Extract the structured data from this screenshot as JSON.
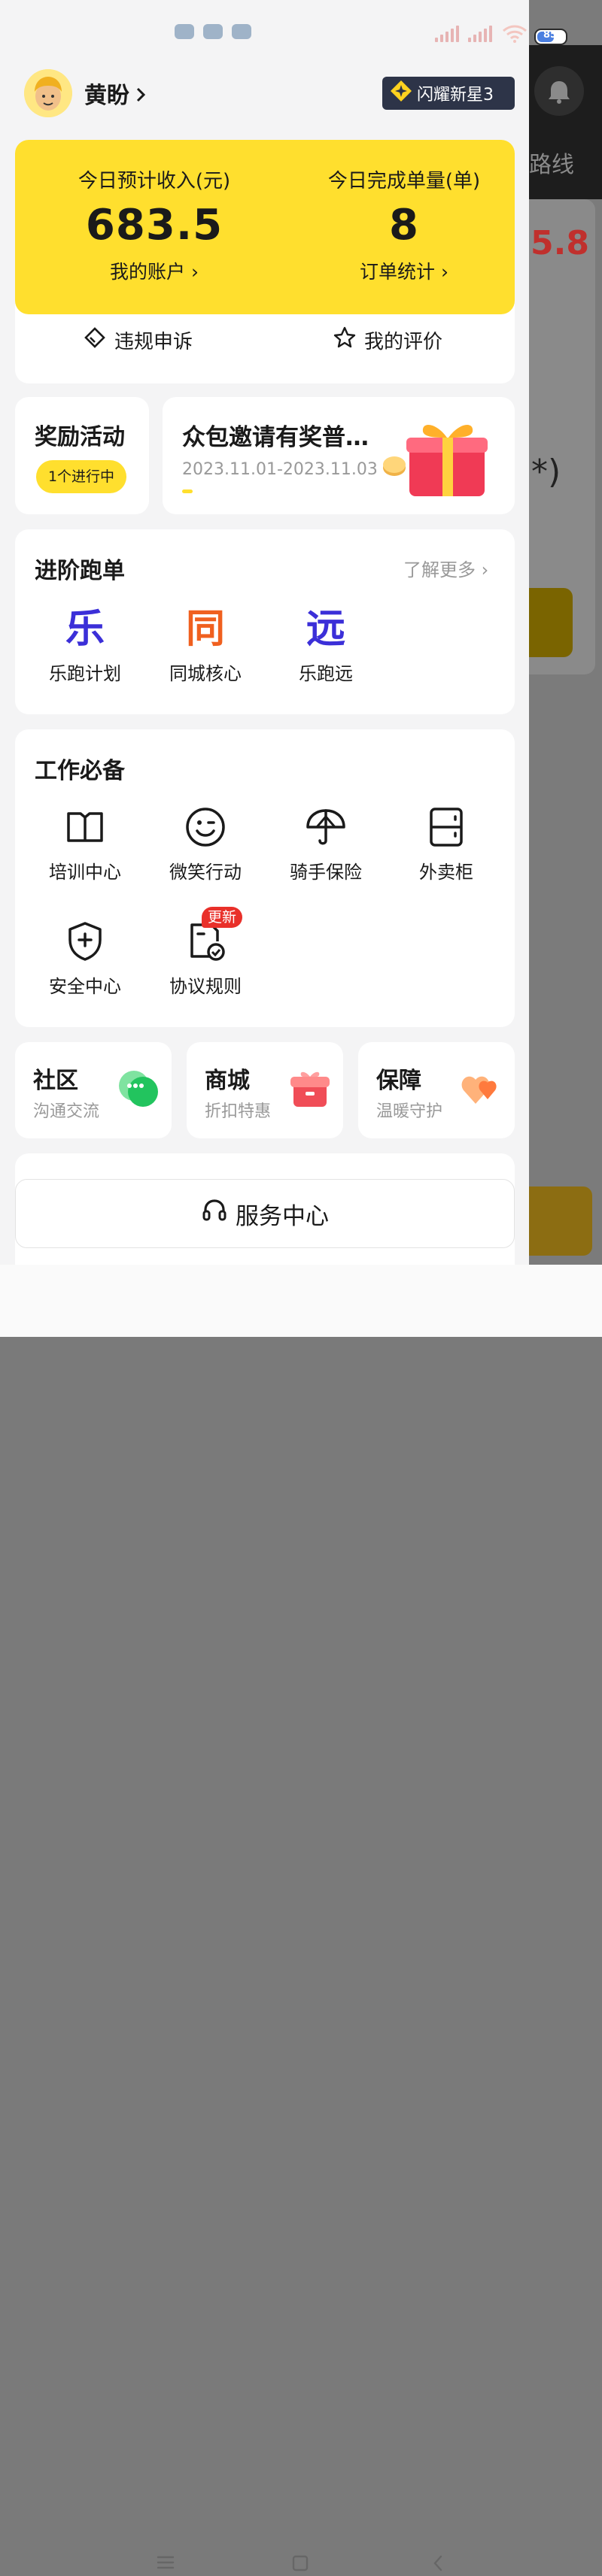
{
  "status_bar": {
    "battery": "85"
  },
  "user": {
    "name": "黄盼",
    "level_badge": "闪耀新星3"
  },
  "earnings": {
    "income_label": "今日预计收入(元)",
    "income_value": "683.5",
    "account_link": "我的账户",
    "orders_label": "今日完成单量(单)",
    "orders_value": "8",
    "orders_link": "订单统计"
  },
  "quick_actions": {
    "appeal": "违规申诉",
    "rating": "我的评价"
  },
  "rewards": {
    "title": "奖励活动",
    "ongoing": "1个进行中",
    "promo_title": "众包邀请有奖普…",
    "promo_dates": "2023.11.01-2023.11.03"
  },
  "advanced": {
    "title": "进阶跑单",
    "more": "了解更多",
    "items": [
      {
        "glyph": "乐",
        "label": "乐跑计划",
        "color": "#3b2fd8"
      },
      {
        "glyph": "同",
        "label": "同城核心",
        "color": "#f0601f"
      },
      {
        "glyph": "远",
        "label": "乐跑远",
        "color": "#3b2fd8"
      }
    ]
  },
  "work": {
    "title": "工作必备",
    "items": [
      {
        "label": "培训中心",
        "icon": "book-icon"
      },
      {
        "label": "微笑行动",
        "icon": "smile-icon"
      },
      {
        "label": "骑手保险",
        "icon": "umbrella-icon"
      },
      {
        "label": "外卖柜",
        "icon": "locker-icon"
      },
      {
        "label": "安全中心",
        "icon": "shield-icon"
      },
      {
        "label": "协议规则",
        "icon": "document-check-icon"
      }
    ],
    "new_tag": "更新"
  },
  "bottom_cards": [
    {
      "title": "社区",
      "subtitle": "沟通交流"
    },
    {
      "title": "商城",
      "subtitle": "折扣特惠"
    },
    {
      "title": "保障",
      "subtitle": "温暖守护"
    }
  ],
  "service_center": "服务中心",
  "background_app": {
    "route_text": "路线",
    "price_text": "5.8",
    "paren": "*)"
  },
  "colors": {
    "accent_yellow": "#ffdf2e",
    "badge_bg": "#2d3448",
    "new_tag": "#e9302a"
  }
}
